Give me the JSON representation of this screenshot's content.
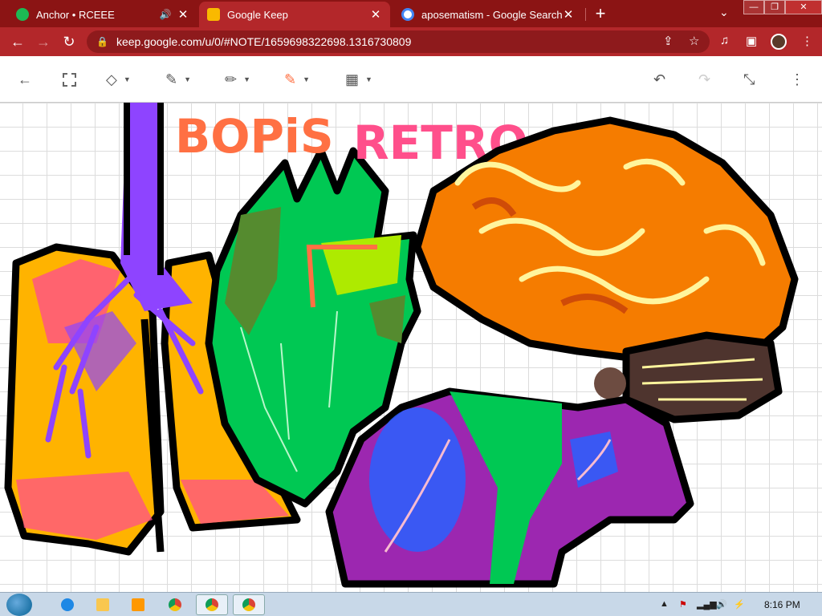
{
  "browser": {
    "tabs": [
      {
        "title": "Anchor • RCEEE",
        "favicon_color": "#1db954",
        "audio_icon": "speaker-icon",
        "active": false
      },
      {
        "title": "Google Keep",
        "favicon_color": "#f9b900",
        "active": true
      },
      {
        "title": "aposematism - Google Search",
        "favicon_color": "#4285f4",
        "active": false
      }
    ],
    "new_tab_label": "+",
    "url": "keep.google.com/u/0/#NOTE/1659698322698.1316730809",
    "theme_color": "#b3272a"
  },
  "window_controls": {
    "minimize": "—",
    "maximize": "❐",
    "close": "✕"
  },
  "keep_toolbar": {
    "tools": [
      "back-arrow-icon",
      "select-icon",
      "eraser-icon",
      "pen-icon",
      "marker-icon",
      "highlighter-icon",
      "grid-icon"
    ],
    "active_pen_color": "#ff6e40",
    "undo": "undo-icon",
    "redo": "redo-icon"
  },
  "drawing": {
    "title_text": "BOPiS RETRO",
    "title_colors": [
      "#ff7043",
      "#ff4f8b"
    ]
  },
  "taskbar": {
    "time": "8:16 PM",
    "apps": [
      "internet-explorer-icon",
      "file-explorer-icon",
      "media-player-icon",
      "chrome-icon",
      "chrome-icon",
      "chrome-icon"
    ]
  }
}
